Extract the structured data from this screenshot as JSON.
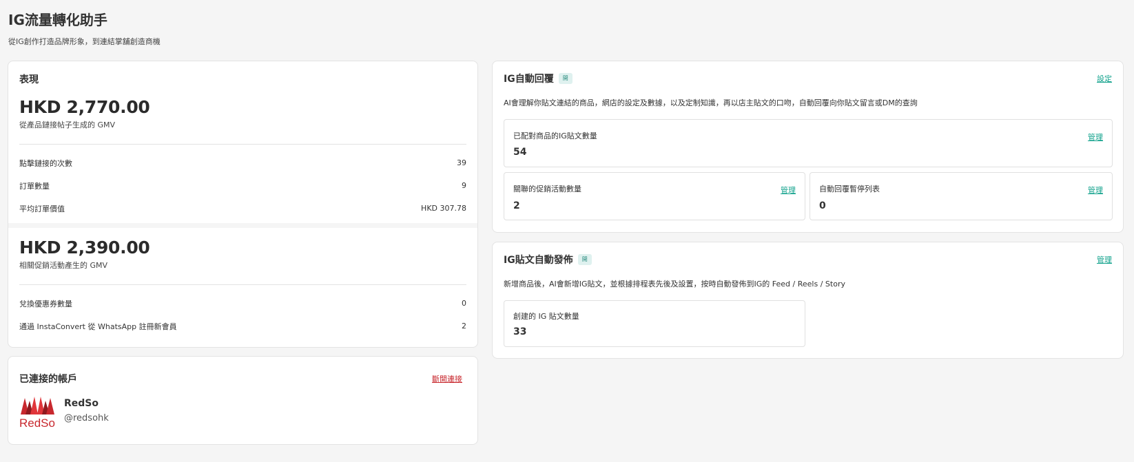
{
  "header": {
    "title": "IG流量轉化助手",
    "subtitle": "從IG創作打造品牌形象，到連結掌舖創造商機"
  },
  "performance": {
    "title": "表現",
    "gmv_product_value": "HKD 2,770.00",
    "gmv_product_caption": "從產品鏈接帖子生成的 GMV",
    "stats_a": [
      {
        "label": "點擊鏈接的次數",
        "value": "39"
      },
      {
        "label": "訂單數量",
        "value": "9"
      },
      {
        "label": "平均訂單價值",
        "value": "HKD 307.78"
      }
    ],
    "gmv_promo_value": "HKD 2,390.00",
    "gmv_promo_caption": "相關促銷活動產生的 GMV",
    "stats_b": [
      {
        "label": "兌換優惠券數量",
        "value": "0"
      },
      {
        "label": "通過 InstaConvert 從 WhatsApp 註冊新會員",
        "value": "2"
      }
    ]
  },
  "account": {
    "title": "已連接的帳戶",
    "disconnect_label": "斷開連接",
    "name": "RedSo",
    "handle": "@redsohk",
    "logo_text": "RedSo",
    "logo_color": "#c8282e"
  },
  "auto_reply": {
    "title": "IG自動回覆",
    "badge": "開",
    "settings_label": "設定",
    "description": "AI會理解你貼文連結的商品，網店的設定及數據，以及定制知識，再以店主貼文的口吻，自動回覆向你貼文留言或DM的查詢",
    "matched_posts": {
      "label": "已配對商品的IG貼文數量",
      "value": "54",
      "action": "管理"
    },
    "promotions": {
      "label": "關聯的促銷活動數量",
      "value": "2",
      "action": "管理"
    },
    "paused_list": {
      "label": "自動回覆暫停列表",
      "value": "0",
      "action": "管理"
    }
  },
  "auto_post": {
    "title": "IG貼文自動發佈",
    "badge": "開",
    "manage_label": "管理",
    "description": "新增商品後，AI會新增IG貼文，並根據排程表先後及設置，按時自動發佈到IG的 Feed / Reels / Story",
    "created_posts": {
      "label": "創建的 IG 貼文數量",
      "value": "33"
    }
  },
  "colors": {
    "accent_green": "#12a28c",
    "danger_red": "#c8282e",
    "badge_bg": "#dff1ef",
    "page_bg": "#f5f5f5"
  }
}
